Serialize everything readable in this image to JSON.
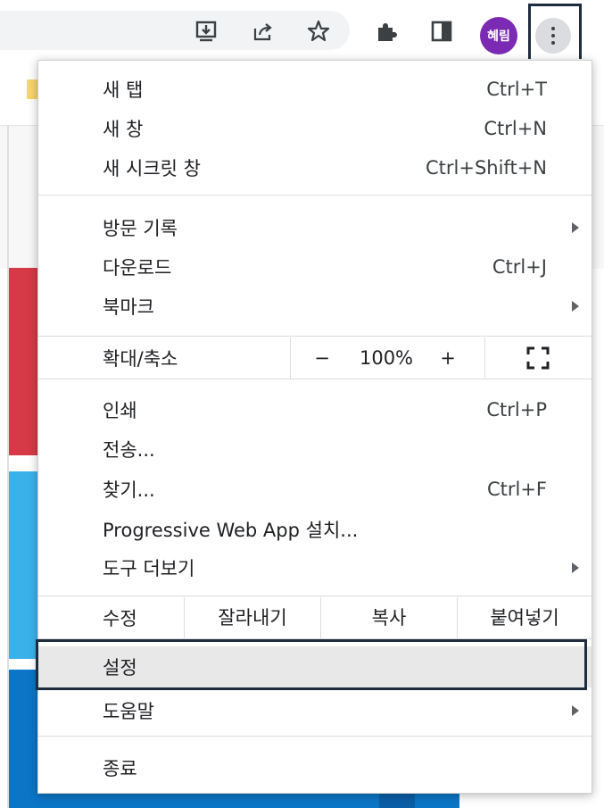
{
  "toolbar": {
    "icons": [
      "install-icon",
      "share-icon",
      "star-icon",
      "extensions-icon",
      "side-panel-icon"
    ],
    "profile_name": "혜림",
    "menu_icon": "three-dot-menu-icon"
  },
  "menu": {
    "new_tab": {
      "label": "새 탭",
      "shortcut": "Ctrl+T"
    },
    "new_window": {
      "label": "새 창",
      "shortcut": "Ctrl+N"
    },
    "new_incognito": {
      "label": "새 시크릿 창",
      "shortcut": "Ctrl+Shift+N"
    },
    "history": {
      "label": "방문 기록"
    },
    "downloads": {
      "label": "다운로드",
      "shortcut": "Ctrl+J"
    },
    "bookmarks": {
      "label": "북마크"
    },
    "zoom": {
      "label": "확대/축소",
      "minus": "−",
      "value": "100%",
      "plus": "+"
    },
    "print": {
      "label": "인쇄",
      "shortcut": "Ctrl+P"
    },
    "cast": {
      "label": "전송..."
    },
    "find": {
      "label": "찾기...",
      "shortcut": "Ctrl+F"
    },
    "install_pwa": {
      "label": "Progressive Web App 설치..."
    },
    "more_tools": {
      "label": "도구 더보기"
    },
    "edit": {
      "label": "수정",
      "cut": "잘라내기",
      "copy": "복사",
      "paste": "붙여넣기"
    },
    "settings": {
      "label": "설정"
    },
    "help": {
      "label": "도움말"
    },
    "exit": {
      "label": "종료"
    }
  },
  "colors": {
    "avatar": "#7b2bb3",
    "highlight_frame": "#1e2c3d",
    "settings_highlight": "#e8e8e8"
  }
}
